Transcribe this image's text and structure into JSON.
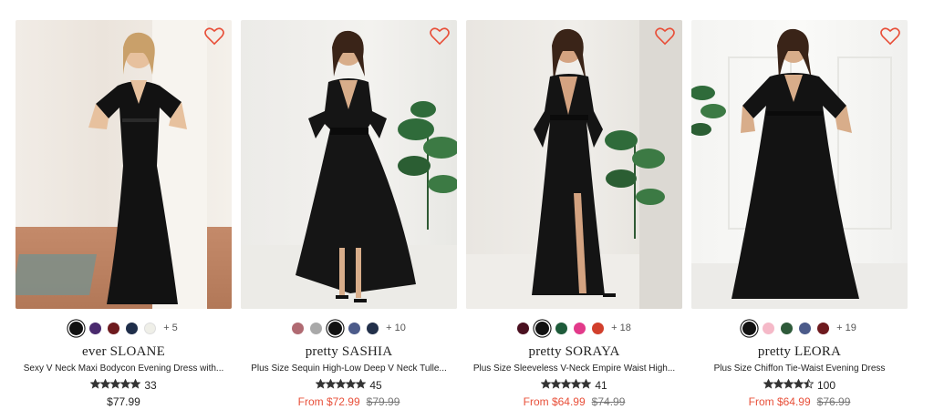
{
  "products": [
    {
      "brand_name": "ever SLOANE",
      "title": "Sexy V Neck Maxi Bodycon Evening Dress with...",
      "swatches": [
        "#111111",
        "#4a2a6e",
        "#6e1a1e",
        "#1f2e4a",
        "#efefe8"
      ],
      "selected_swatch": 0,
      "more_colors": "+ 5",
      "rating": 5,
      "reviews": "33",
      "price": "$77.99",
      "original_price": "",
      "price_is_sale": false
    },
    {
      "brand_name": "pretty SASHIA",
      "title": "Plus Size Sequin High-Low Deep V Neck Tulle...",
      "swatches": [
        "#b06a72",
        "#a9a9a9",
        "#111111",
        "#4c5b8a",
        "#22304a"
      ],
      "selected_swatch": 2,
      "more_colors": "+ 10",
      "rating": 5,
      "reviews": "45",
      "price": "From $72.99",
      "original_price": "$79.99",
      "price_is_sale": true
    },
    {
      "brand_name": "pretty SORAYA",
      "title": "Plus Size Sleeveless V-Neck Empire Waist High...",
      "swatches": [
        "#4a1020",
        "#111111",
        "#1e5b3a",
        "#e23a8a",
        "#d13f2c"
      ],
      "selected_swatch": 1,
      "more_colors": "+ 18",
      "rating": 5,
      "reviews": "41",
      "price": "From $64.99",
      "original_price": "$74.99",
      "price_is_sale": true
    },
    {
      "brand_name": "pretty LEORA",
      "title": "Plus Size Chiffon Tie-Waist Evening Dress",
      "swatches": [
        "#111111",
        "#f5b9c8",
        "#2e5a3a",
        "#4c5b8a",
        "#6e1a1e"
      ],
      "selected_swatch": 0,
      "more_colors": "+ 19",
      "rating": 4.5,
      "reviews": "100",
      "price": "From $64.99",
      "original_price": "$76.99",
      "price_is_sale": true
    }
  ],
  "colors": {
    "sale_price": "#e8503a",
    "heart": "#e8503a",
    "star": "#333333"
  },
  "icons": {
    "wishlist": "heart-outline-icon",
    "rating": "star-icon"
  }
}
